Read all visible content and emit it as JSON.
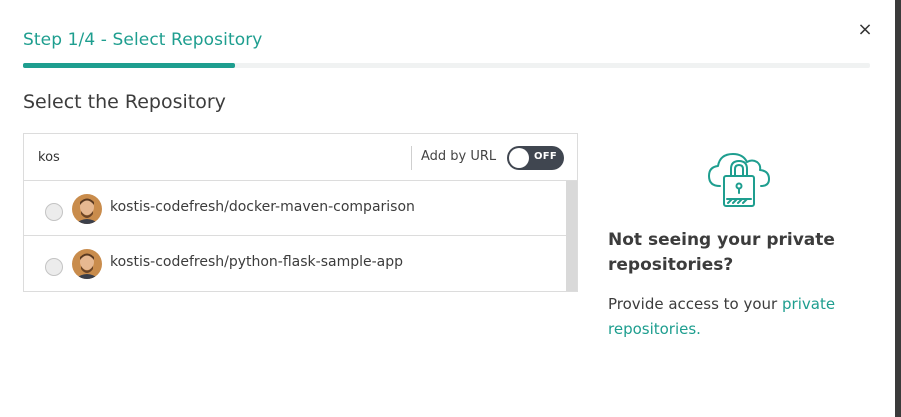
{
  "dialog": {
    "close_glyph": "×",
    "step_title": "Step 1/4 - Select Repository",
    "progress": {
      "current_step": 1,
      "total_steps": 4,
      "fraction": 0.25
    },
    "section_title": "Select the Repository",
    "accent_color": "#1e9e8f"
  },
  "search": {
    "value": "kos",
    "add_by_url_label": "Add by URL",
    "toggle": {
      "state": "OFF",
      "on": false,
      "color": "#404650"
    }
  },
  "repositories": [
    {
      "name": "kostis-codefresh/docker-maven-comparison",
      "selected": false,
      "avatar_icon": "user-avatar"
    },
    {
      "name": "kostis-codefresh/python-flask-sample-app",
      "selected": false,
      "avatar_icon": "user-avatar"
    }
  ],
  "private_info": {
    "icon": "cloud-lock-icon",
    "heading": "Not seeing your private repositories?",
    "text": "Provide access to your",
    "link": "private repositories."
  }
}
